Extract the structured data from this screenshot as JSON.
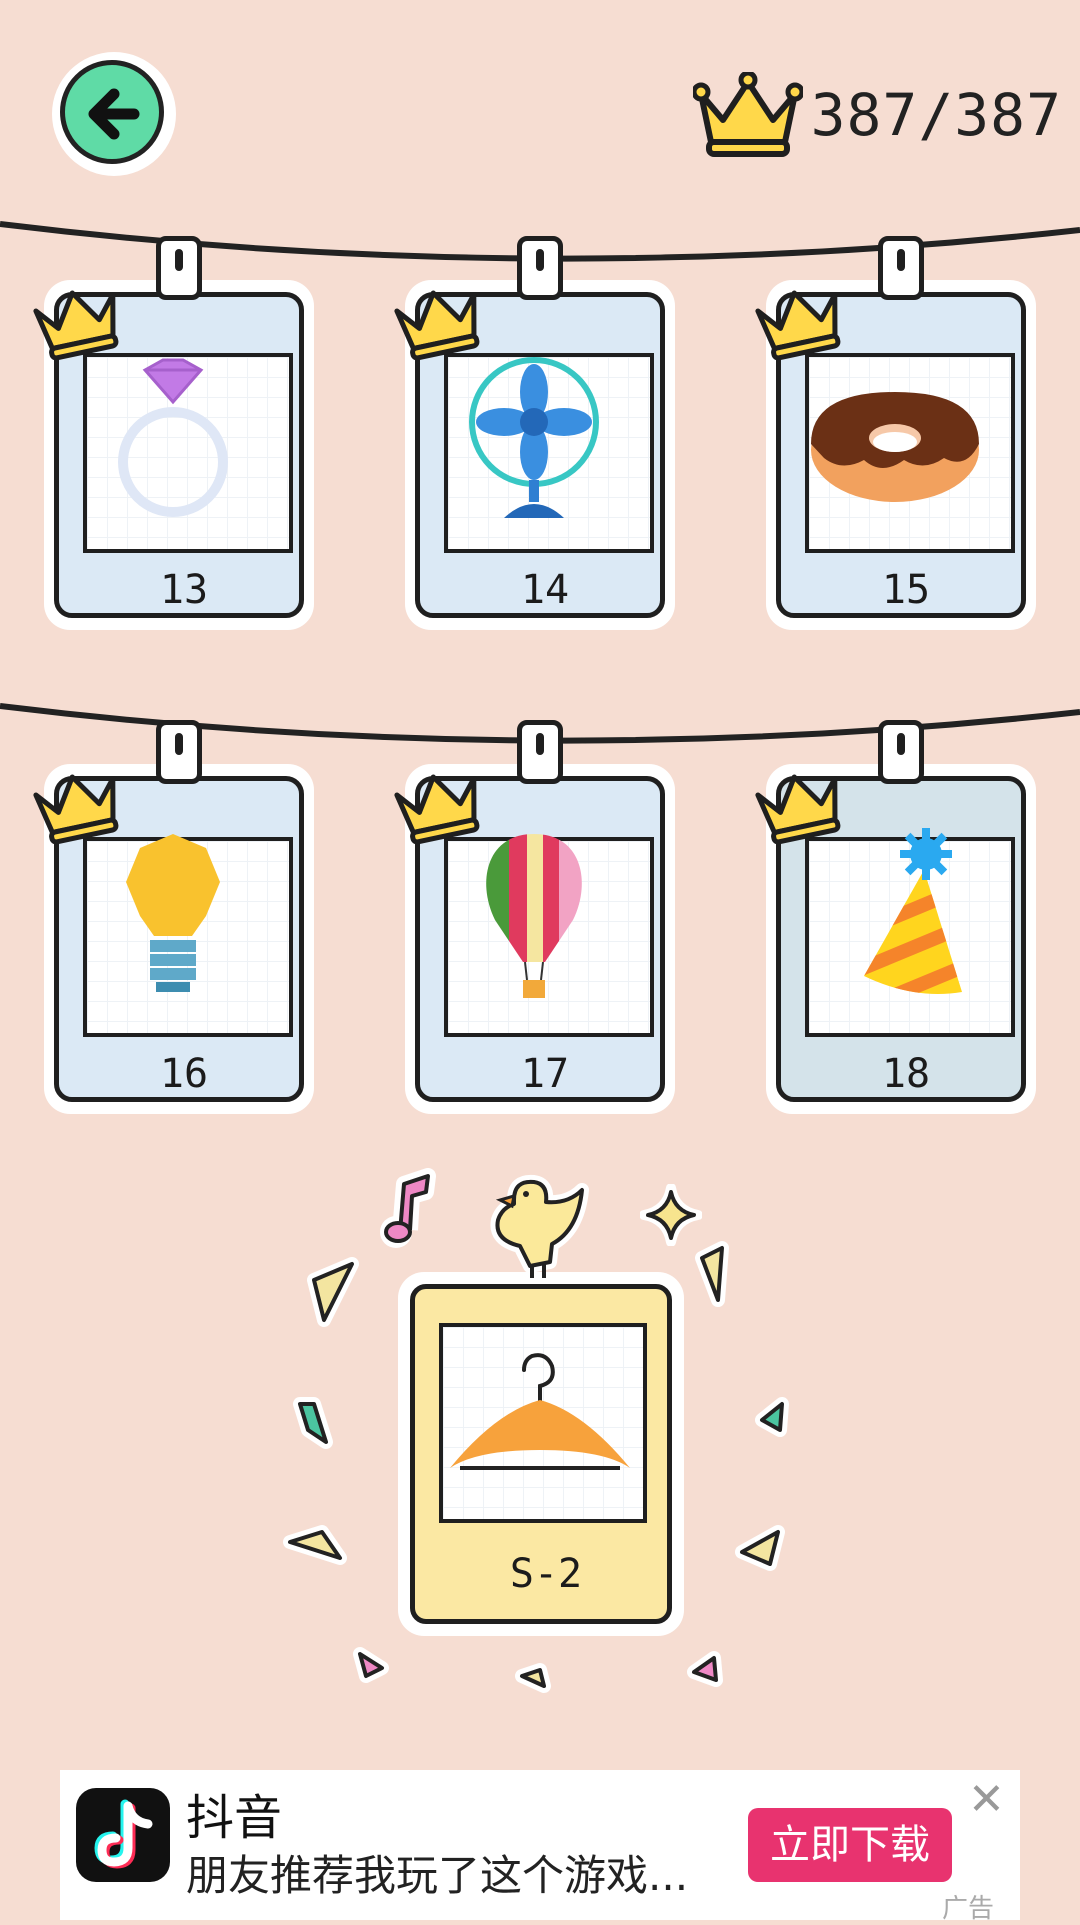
{
  "header": {
    "back_icon": "back-arrow-icon",
    "crown_icon": "crown-icon",
    "score": "387/387"
  },
  "cards": [
    {
      "label": "13",
      "icon": "diamond-ring-icon",
      "completed": true
    },
    {
      "label": "14",
      "icon": "fan-icon",
      "completed": true
    },
    {
      "label": "15",
      "icon": "donut-icon",
      "completed": true
    },
    {
      "label": "16",
      "icon": "light-bulb-icon",
      "completed": true
    },
    {
      "label": "17",
      "icon": "hot-air-balloon-icon",
      "completed": true
    },
    {
      "label": "18",
      "icon": "party-hat-icon",
      "completed": true
    }
  ],
  "special_card": {
    "label": "S-2",
    "icon": "hanger-icon",
    "decorations": [
      "bird-icon",
      "music-note-icon",
      "sparkle-icon"
    ]
  },
  "ad": {
    "app_name": "抖音",
    "description": "朋友推荐我玩了这个游戏...",
    "cta_label": "立即下载",
    "tag": "广告",
    "close_icon": "close-icon"
  },
  "colors": {
    "background": "#f6ddd2",
    "card_blue": "#dbe9f5",
    "special_yellow": "#fbe8a3",
    "back_green": "#5fdba6",
    "cta_pink": "#e8336f"
  }
}
